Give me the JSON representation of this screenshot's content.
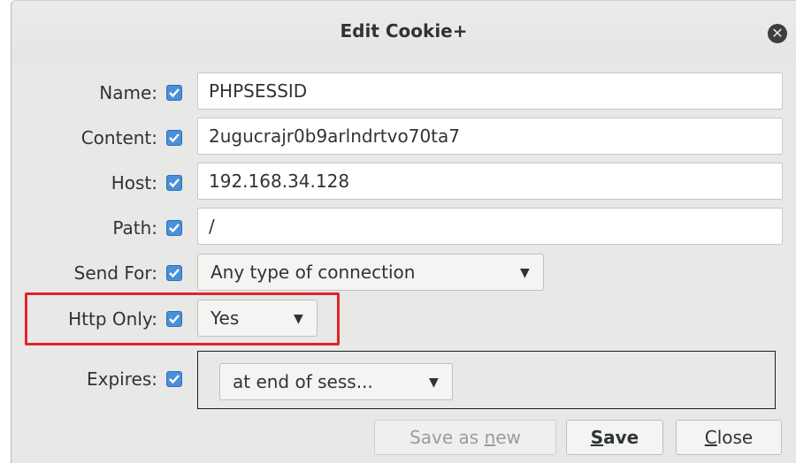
{
  "dialog": {
    "title": "Edit Cookie+"
  },
  "fields": [
    {
      "label": "Name:",
      "value": "PHPSESSID"
    },
    {
      "label": "Content:",
      "value": "2ugucrajr0b9arlndrtvo70ta7"
    },
    {
      "label": "Host:",
      "value": "192.168.34.128"
    },
    {
      "label": "Path:",
      "value": "/"
    }
  ],
  "send_for": {
    "label": "Send For:",
    "value": "Any type of connection"
  },
  "http_only": {
    "label": "Http Only:",
    "value": "Yes"
  },
  "expires": {
    "label": "Expires:",
    "value": "at end of sess..."
  },
  "buttons": {
    "save_as_new": {
      "pre": "Save as ",
      "key": "n",
      "post": "ew"
    },
    "save": {
      "pre": "",
      "key": "S",
      "post": "ave"
    },
    "close": {
      "pre": "",
      "key": "C",
      "post": "lose"
    }
  },
  "colors": {
    "checkbox": "#4a90d9",
    "highlight": "#e0242a"
  },
  "icons": {
    "checkbox": "check-icon",
    "close": "close-icon",
    "dropdown": "chevron-down-icon"
  }
}
